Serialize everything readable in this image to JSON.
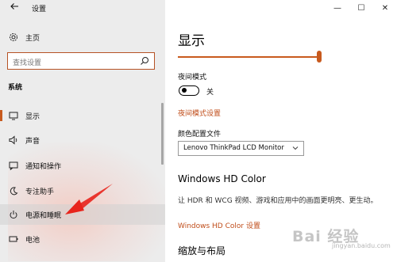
{
  "window": {
    "title": "设置",
    "controls": [
      "—",
      "☐",
      "✕"
    ]
  },
  "sidebar": {
    "home_label": "主页",
    "search_placeholder": "查找设置",
    "section_label": "系统",
    "items": [
      {
        "label": "显示",
        "icon": "monitor-icon",
        "active": true
      },
      {
        "label": "声音",
        "icon": "speaker-icon"
      },
      {
        "label": "通知和操作",
        "icon": "notification-icon"
      },
      {
        "label": "专注助手",
        "icon": "moon-icon"
      },
      {
        "label": "电源和睡眠",
        "icon": "power-icon"
      },
      {
        "label": "电池",
        "icon": "battery-icon"
      }
    ]
  },
  "main": {
    "title": "显示",
    "brightness_percent": 100,
    "night_light": {
      "label": "夜间模式",
      "state_text": "关",
      "settings_link": "夜间模式设置"
    },
    "color_profile": {
      "label": "颜色配置文件",
      "selected": "Lenovo ThinkPad LCD Monitor"
    },
    "hd_color": {
      "heading": "Windows HD Color",
      "description": "让 HDR 和 WCG 视频、游戏和应用中的画面更明亮、更生动。",
      "link": "Windows HD Color 设置"
    },
    "scale_heading": "缩放与布局"
  },
  "watermark": {
    "text": "Bai 经验",
    "subtext": "jingyan.baidu.com"
  },
  "colors": {
    "accent": "#c85a1e",
    "sidebar_bg": "#ececec",
    "annotation_arrow": "#e8241c"
  }
}
